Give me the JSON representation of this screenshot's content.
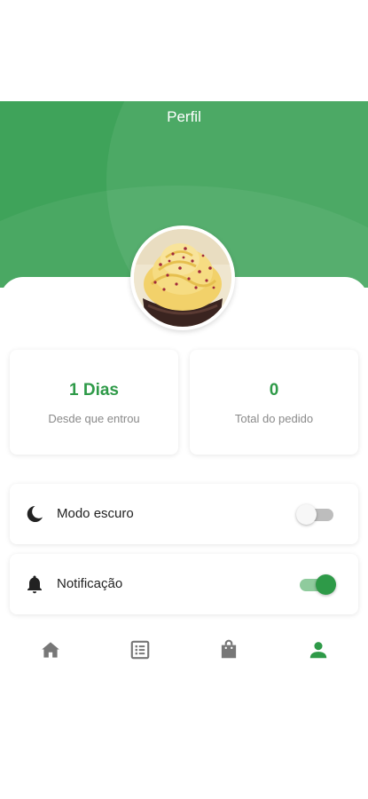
{
  "header": {
    "title": "Perfil"
  },
  "colors": {
    "primary": "#3fa35a",
    "accent": "#2e9a48",
    "nav_inactive": "#777777"
  },
  "avatar": {
    "icon": "cupcake-photo"
  },
  "stats": [
    {
      "value": "1 Dias",
      "label": "Desde que entrou"
    },
    {
      "value": "0",
      "label": "Total do pedido"
    }
  ],
  "settings": {
    "dark_mode": {
      "label": "Modo escuro",
      "icon": "moon-icon",
      "enabled": false
    },
    "notifications": {
      "label": "Notificação",
      "icon": "bell-icon",
      "enabled": true
    }
  },
  "bottom_nav": [
    {
      "icon": "home-icon",
      "active": false
    },
    {
      "icon": "list-icon",
      "active": false
    },
    {
      "icon": "shopping-bag-icon",
      "active": false
    },
    {
      "icon": "person-icon",
      "active": true
    }
  ]
}
